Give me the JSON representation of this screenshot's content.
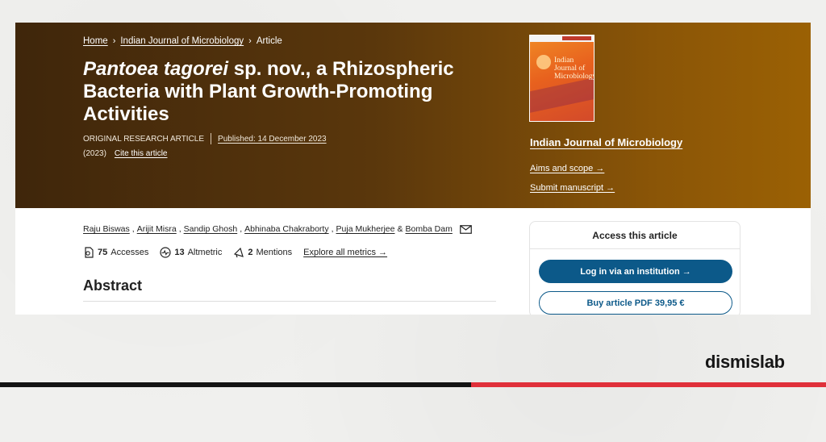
{
  "breadcrumb": {
    "items": [
      "Home",
      "Indian Journal of Microbiology",
      "Article"
    ]
  },
  "article": {
    "title_italic": "Pantoea tagorei",
    "title_rest": " sp. nov., a Rhizospheric Bacteria with Plant Growth-Promoting Activities",
    "type": "ORIGINAL RESEARCH ARTICLE",
    "published": "Published: 14 December 2023",
    "year": "(2023)",
    "cite": "Cite this article"
  },
  "journal": {
    "cover_title": "Indian Journal of Microbiology",
    "name": "Indian Journal of Microbiology",
    "aims": "Aims and scope →",
    "submit": "Submit manuscript →"
  },
  "authors": [
    "Raju Biswas",
    "Arijit Misra",
    "Sandip Ghosh",
    "Abhinaba Chakraborty",
    "Puja Mukherjee",
    "Bomba Dam"
  ],
  "metrics": {
    "accesses_count": "75",
    "accesses_label": "Accesses",
    "altmetric_count": "13",
    "altmetric_label": "Altmetric",
    "mentions_count": "2",
    "mentions_label": "Mentions",
    "explore": "Explore all metrics →"
  },
  "abstract_heading": "Abstract",
  "access": {
    "heading": "Access this article",
    "login": "Log in via an institution  →",
    "buy": "Buy article PDF 39,95 €"
  },
  "brand": "dismislab",
  "colors": {
    "hero_dark": "#3f260b",
    "hero_light": "#9b6104",
    "button_blue": "#0c5989",
    "accent_red": "#e0303a"
  }
}
